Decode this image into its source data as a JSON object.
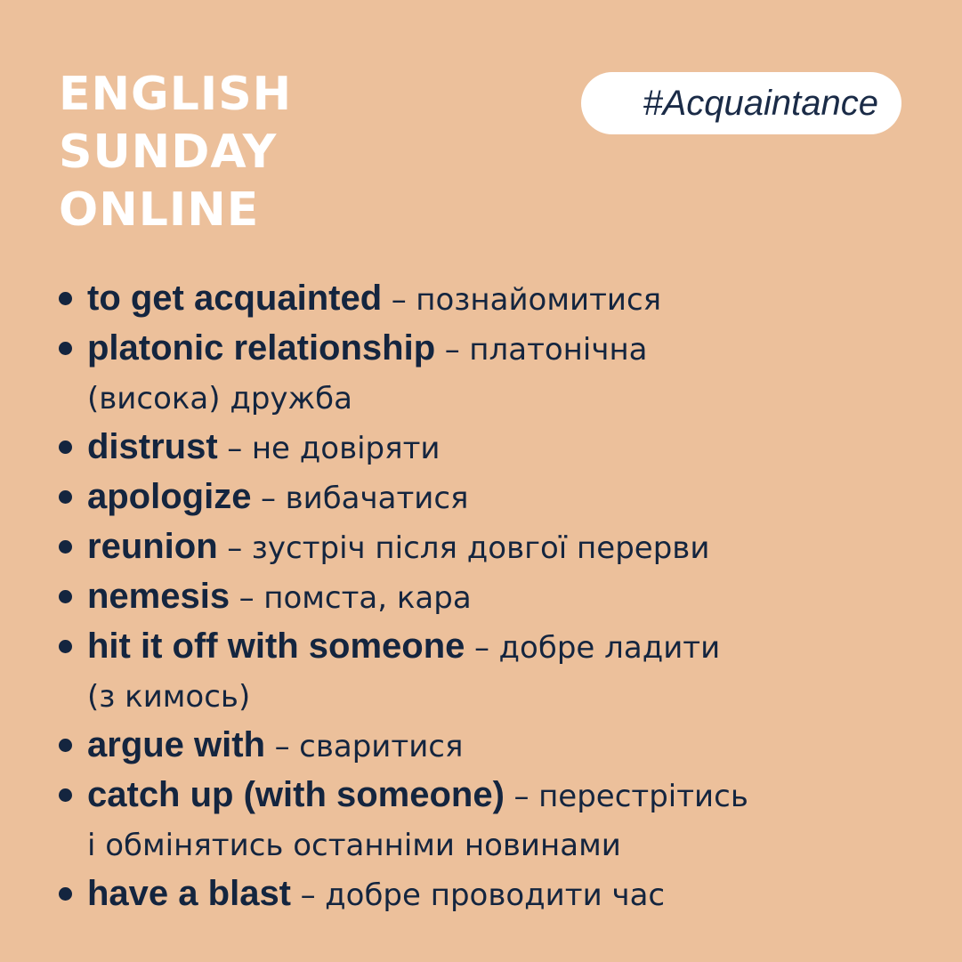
{
  "brand": {
    "lines": [
      "ENGLISH",
      "SUNDAY",
      "ONLINE"
    ]
  },
  "tag": "#Acquaintance",
  "colors": {
    "background": "#ecc09b",
    "text": "#14253f",
    "brand_text": "#ffffff",
    "tag_background": "#ffffff"
  },
  "vocab": [
    {
      "term": "to get acquainted",
      "dash": "–",
      "translation": [
        "познайомитися"
      ]
    },
    {
      "term": "platonic relationship",
      "dash": "–",
      "translation": [
        "платонічна",
        "(висока) дружба"
      ]
    },
    {
      "term": "distrust",
      "dash": "–",
      "translation": [
        "не довіряти"
      ]
    },
    {
      "term": "apologize",
      "dash": "–",
      "translation": [
        "вибачатися"
      ]
    },
    {
      "term": "reunion",
      "dash": "–",
      "translation": [
        "зустріч після довгої перерви"
      ]
    },
    {
      "term": "nemesis",
      "dash": "–",
      "translation": [
        "помста, кара"
      ]
    },
    {
      "term": "hit it off with someone",
      "dash": "–",
      "translation": [
        "добре ладити",
        "(з кимось)"
      ]
    },
    {
      "term": "argue with",
      "dash": "–",
      "translation": [
        "сваритися"
      ]
    },
    {
      "term": "catch up (with someone)",
      "dash": "–",
      "translation": [
        "перестрітись",
        "і обмінятись останніми новинами"
      ]
    },
    {
      "term": "have a blast",
      "dash": "–",
      "translation": [
        "добре проводити час"
      ]
    }
  ]
}
